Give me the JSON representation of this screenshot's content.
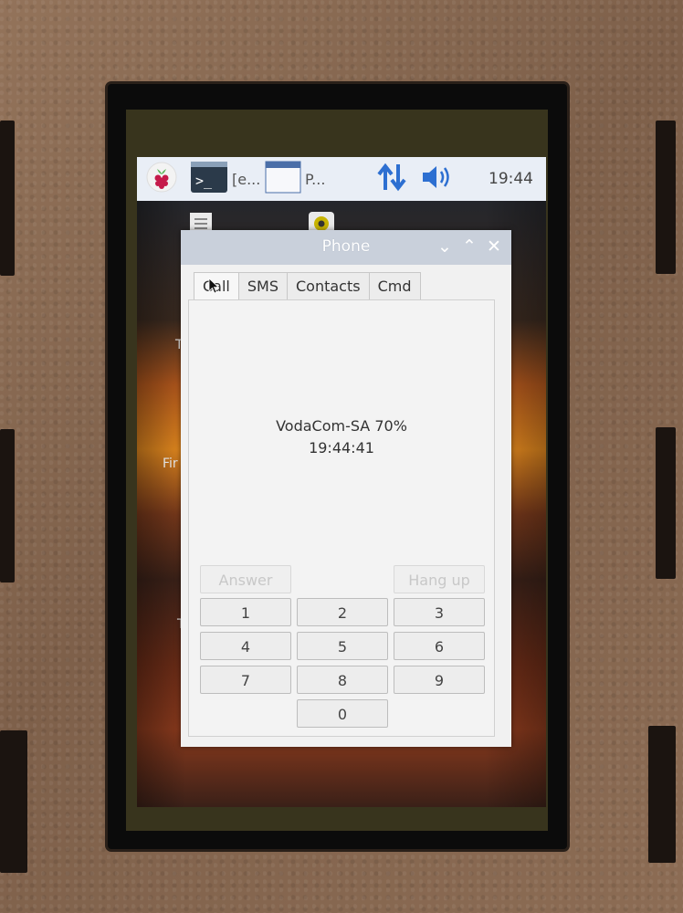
{
  "taskbar": {
    "terminal_label": "[e...",
    "phone_label": "P...",
    "clock": "19:44"
  },
  "desktop": {
    "labels": [
      "T",
      "Fir",
      "T"
    ]
  },
  "window": {
    "title": "Phone",
    "tabs": [
      "Call",
      "SMS",
      "Contacts",
      "Cmd"
    ],
    "network": "VodaCom-SA 70%",
    "time": "19:44:41",
    "answer_label": "Answer",
    "hangup_label": "Hang up",
    "keys": [
      "1",
      "2",
      "3",
      "4",
      "5",
      "6",
      "7",
      "8",
      "9",
      "0"
    ]
  },
  "colors": {
    "taskbar": "#e9eef6",
    "titlebar": "#c9d0db",
    "accent_blue": "#2d6fd1"
  }
}
